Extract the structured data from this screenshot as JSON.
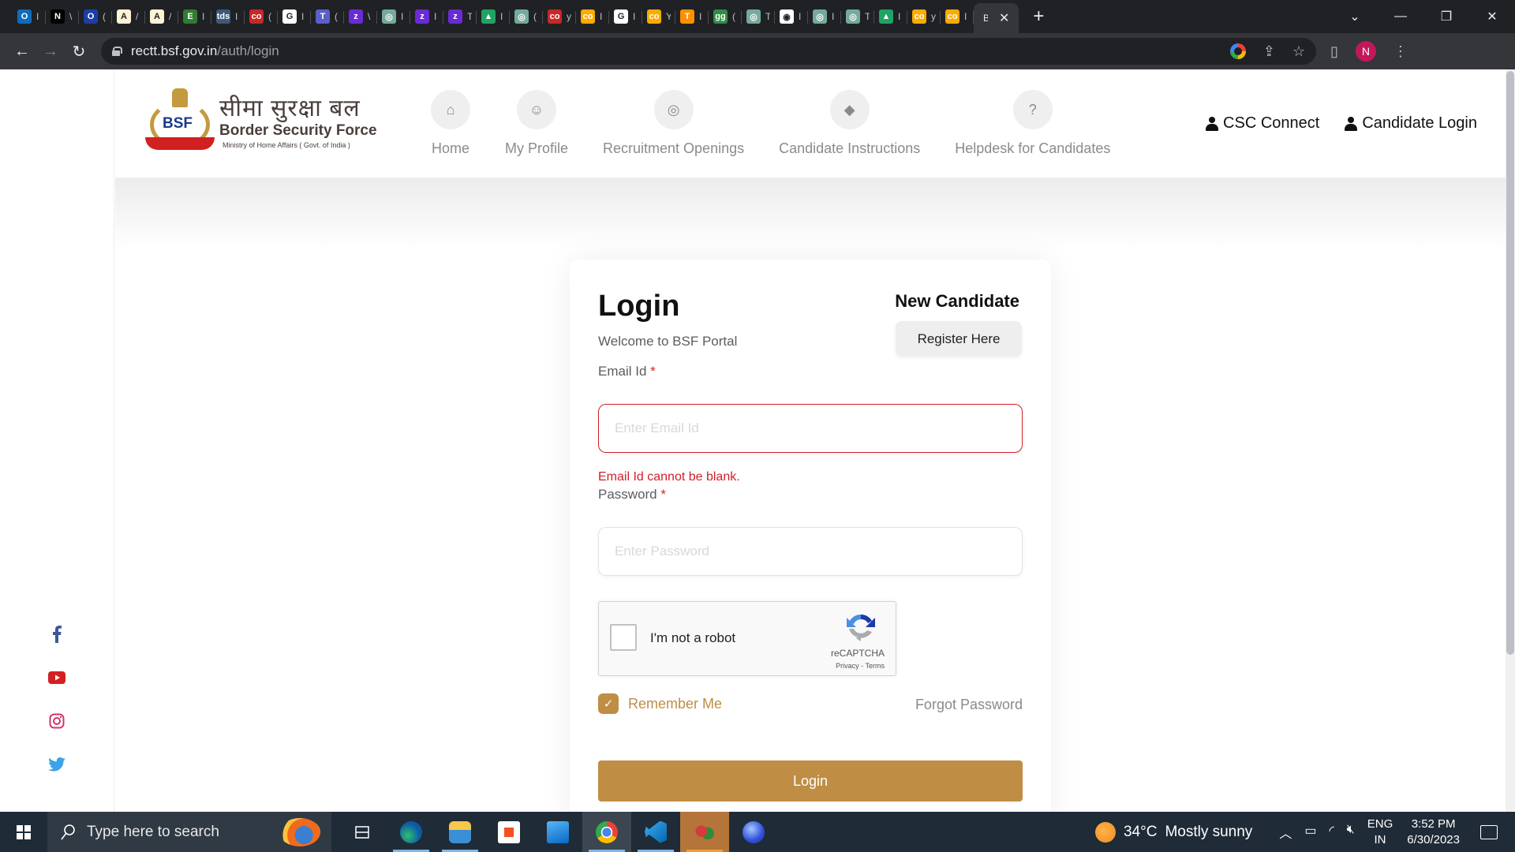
{
  "browser": {
    "tabs": [
      {
        "icon": "outlook-icon",
        "color": "#0f6cbd",
        "glyph": "O",
        "title": "I"
      },
      {
        "icon": "notion-icon",
        "color": "#000000",
        "glyph": "N",
        "title": "\\"
      },
      {
        "icon": "circle-app-icon",
        "color": "#1a3fa8",
        "glyph": "O",
        "title": "("
      },
      {
        "icon": "ae-icon",
        "color": "#fff3d6",
        "glyph": "A",
        "title": "/"
      },
      {
        "icon": "ae-icon",
        "color": "#fff3d6",
        "glyph": "A",
        "title": "/"
      },
      {
        "icon": "mask-icon",
        "color": "#2e7d32",
        "glyph": "E",
        "title": "I"
      },
      {
        "icon": "tds-icon",
        "color": "#3b5a7a",
        "glyph": "tds",
        "title": "I"
      },
      {
        "icon": "colab-icon",
        "color": "#c62828",
        "glyph": "co",
        "title": "("
      },
      {
        "icon": "github-icon",
        "color": "#ffffff",
        "glyph": "G",
        "title": "I"
      },
      {
        "icon": "teams-icon",
        "color": "#5b5fc7",
        "glyph": "T",
        "title": "("
      },
      {
        "icon": "app-z-icon",
        "color": "#6a2bd6",
        "glyph": "z",
        "title": "\\"
      },
      {
        "icon": "chatgpt-icon",
        "color": "#74aa9c",
        "glyph": "◎",
        "title": "I"
      },
      {
        "icon": "app-z-icon",
        "color": "#6a2bd6",
        "glyph": "z",
        "title": "I"
      },
      {
        "icon": "app-z-icon",
        "color": "#6a2bd6",
        "glyph": "z",
        "title": "T"
      },
      {
        "icon": "drive-icon",
        "color": "#1fa463",
        "glyph": "▲",
        "title": "I"
      },
      {
        "icon": "chatgpt-icon",
        "color": "#74aa9c",
        "glyph": "◎",
        "title": "("
      },
      {
        "icon": "colab-icon",
        "color": "#c62828",
        "glyph": "co",
        "title": "y"
      },
      {
        "icon": "colab-icon",
        "color": "#f9ab00",
        "glyph": "co",
        "title": "I"
      },
      {
        "icon": "google-icon",
        "color": "#ffffff",
        "glyph": "G",
        "title": "I"
      },
      {
        "icon": "colab-icon",
        "color": "#f9ab00",
        "glyph": "co",
        "title": "Y"
      },
      {
        "icon": "tensorflow-icon",
        "color": "#ff8f00",
        "glyph": "T",
        "title": "I"
      },
      {
        "icon": "geeksforgeeks-icon",
        "color": "#2f8d46",
        "glyph": "gg",
        "title": "("
      },
      {
        "icon": "chatgpt-icon",
        "color": "#74aa9c",
        "glyph": "◎",
        "title": "T"
      },
      {
        "icon": "chrome-icon",
        "color": "#ffffff",
        "glyph": "◉",
        "title": "I"
      },
      {
        "icon": "chatgpt-icon",
        "color": "#74aa9c",
        "glyph": "◎",
        "title": "I"
      },
      {
        "icon": "chatgpt-icon",
        "color": "#74aa9c",
        "glyph": "◎",
        "title": "T"
      },
      {
        "icon": "drive-icon",
        "color": "#1fa463",
        "glyph": "▲",
        "title": "I"
      },
      {
        "icon": "colab-icon",
        "color": "#f9ab00",
        "glyph": "co",
        "title": "y"
      },
      {
        "icon": "colab-icon",
        "color": "#f9ab00",
        "glyph": "co",
        "title": "I"
      }
    ],
    "active_tab": {
      "title": "B"
    },
    "url_host": "rectt.bsf.gov.in",
    "url_path": "/auth/login",
    "profile_initial": "N"
  },
  "site": {
    "logo": {
      "hindi": "सीमा सुरक्षा बल",
      "english": "Border Security Force",
      "ministry": "Ministry of Home Affairs ( Govt. of India )",
      "mark": "BSF"
    },
    "nav": [
      {
        "label": "Home",
        "icon": "home-icon",
        "glyph": "⌂"
      },
      {
        "label": "My Profile",
        "icon": "add-user-icon",
        "glyph": "☺"
      },
      {
        "label": "Recruitment Openings",
        "icon": "globe-icon",
        "glyph": "◎"
      },
      {
        "label": "Candidate Instructions",
        "icon": "directions-icon",
        "glyph": "◆"
      },
      {
        "label": "Helpdesk for Candidates",
        "icon": "question-icon",
        "glyph": "?"
      }
    ],
    "user_links": {
      "csc": "CSC Connect",
      "candidate_login": "Candidate Login"
    }
  },
  "login": {
    "title": "Login",
    "subtitle": "Welcome to BSF Portal",
    "new_candidate": "New Candidate",
    "register_button": "Register Here",
    "email": {
      "label": "Email Id",
      "required_mark": "*",
      "placeholder": "Enter Email Id",
      "value": "",
      "error": "Email Id cannot be blank."
    },
    "password": {
      "label": "Password",
      "required_mark": "*",
      "placeholder": "Enter Password",
      "value": ""
    },
    "captcha": {
      "label": "I'm not a robot",
      "brand": "reCAPTCHA",
      "links": "Privacy - Terms",
      "checked": false
    },
    "remember_me": {
      "label": "Remember Me",
      "checked": true
    },
    "forgot_password": "Forgot Password",
    "submit": "Login",
    "accent_color": "#bf8d44",
    "error_color": "#d1202a"
  },
  "social": [
    "facebook-icon",
    "youtube-icon",
    "instagram-icon",
    "twitter-icon"
  ],
  "taskbar": {
    "search_placeholder": "Type here to search",
    "weather": {
      "temp": "34°C",
      "desc": "Mostly sunny"
    },
    "lang_top": "ENG",
    "lang_bottom": "IN",
    "time": "3:52 PM",
    "date": "6/30/2023"
  }
}
